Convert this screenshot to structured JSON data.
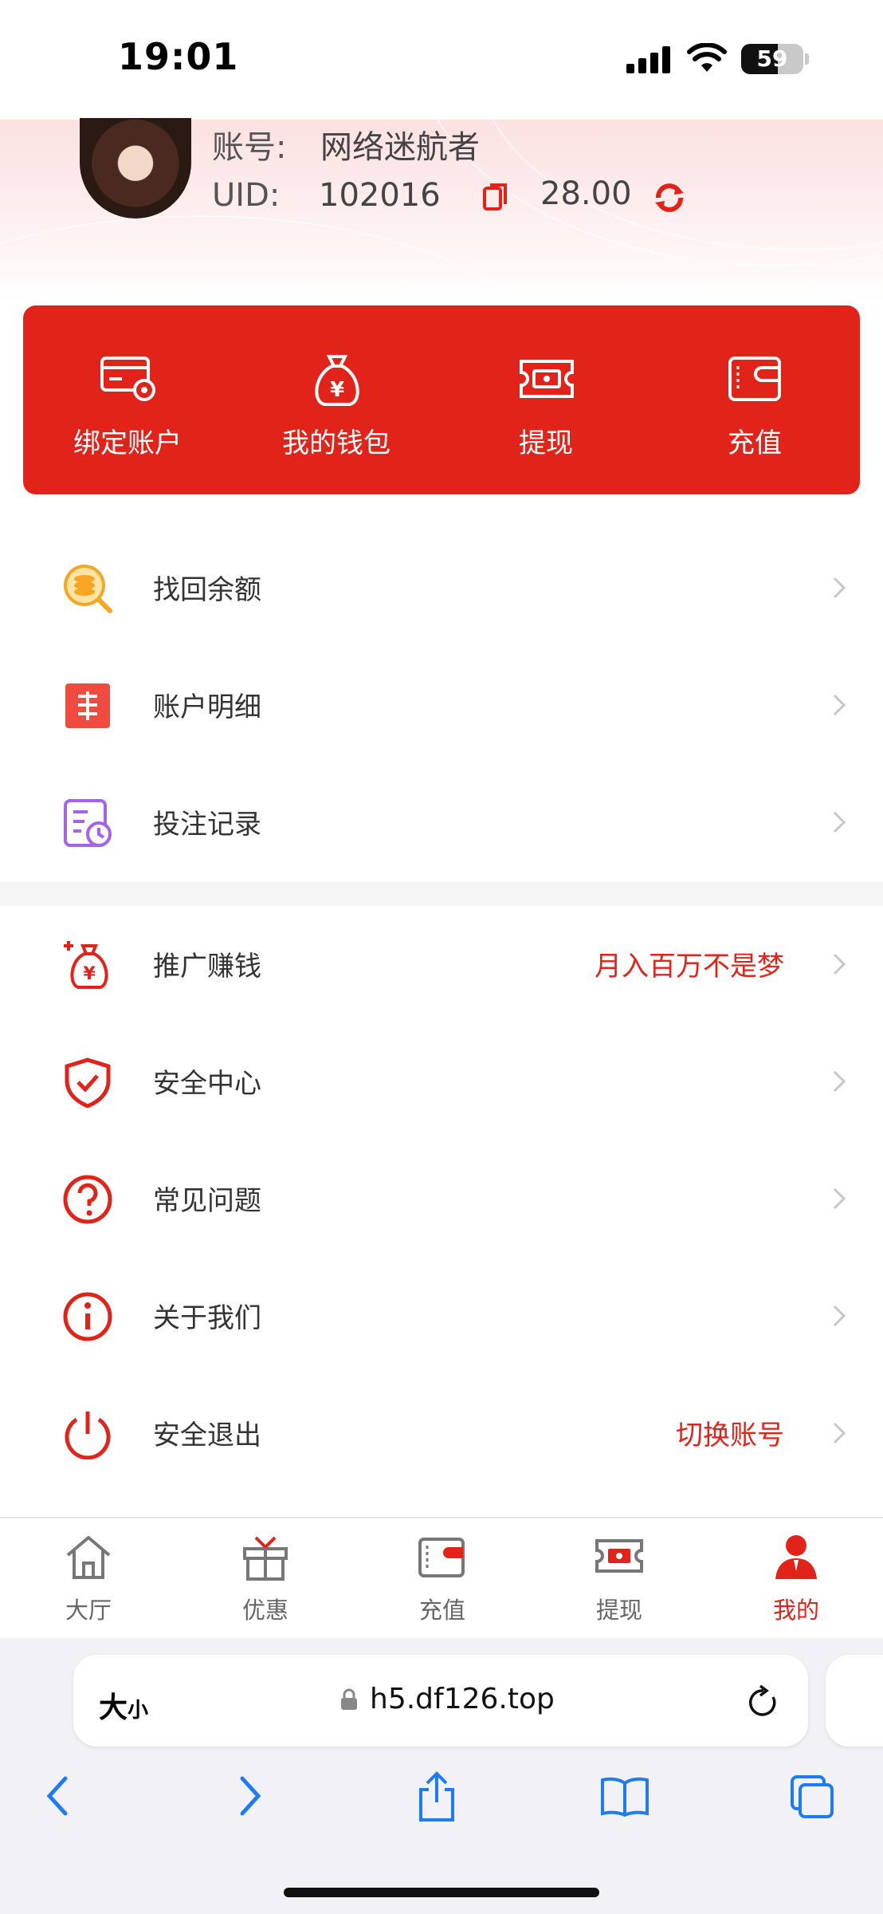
{
  "status": {
    "time": "19:01",
    "battery": "59",
    "battery_level": 0.59
  },
  "profile": {
    "account_label": "账号:",
    "account_value": "网络迷航者",
    "uid_label": "UID:",
    "uid_value": "102016",
    "balance": "28.00"
  },
  "actions": [
    {
      "label": "绑定账户",
      "icon": "card-settings-icon"
    },
    {
      "label": "我的钱包",
      "icon": "money-bag-icon"
    },
    {
      "label": "提现",
      "icon": "ticket-cash-icon"
    },
    {
      "label": "充值",
      "icon": "wallet-icon"
    }
  ],
  "menu_group1": [
    {
      "label": "找回余额",
      "icon": "coin-search-icon",
      "extra": ""
    },
    {
      "label": "账户明细",
      "icon": "yuan-list-icon",
      "extra": ""
    },
    {
      "label": "投注记录",
      "icon": "bet-record-icon",
      "extra": ""
    }
  ],
  "menu_group2": [
    {
      "label": "推广赚钱",
      "icon": "money-bag-plus-icon",
      "extra": "月入百万不是梦"
    },
    {
      "label": "安全中心",
      "icon": "shield-check-icon",
      "extra": ""
    },
    {
      "label": "常见问题",
      "icon": "question-circle-icon",
      "extra": ""
    },
    {
      "label": "关于我们",
      "icon": "info-circle-icon",
      "extra": ""
    },
    {
      "label": "安全退出",
      "icon": "power-icon",
      "extra": "切换账号"
    }
  ],
  "tabs": [
    {
      "label": "大厅",
      "icon": "home-icon",
      "active": false
    },
    {
      "label": "优惠",
      "icon": "gift-icon",
      "active": false
    },
    {
      "label": "充值",
      "icon": "wallet-icon",
      "active": false
    },
    {
      "label": "提现",
      "icon": "ticket-cash-icon",
      "active": false
    },
    {
      "label": "我的",
      "icon": "user-icon",
      "active": true
    }
  ],
  "browser": {
    "text_size": "大",
    "text_size_small": "小",
    "url": "h5.df126.top"
  },
  "colors": {
    "accent": "#e2231a",
    "coin": "#f5a623",
    "purple": "#a463e8"
  }
}
